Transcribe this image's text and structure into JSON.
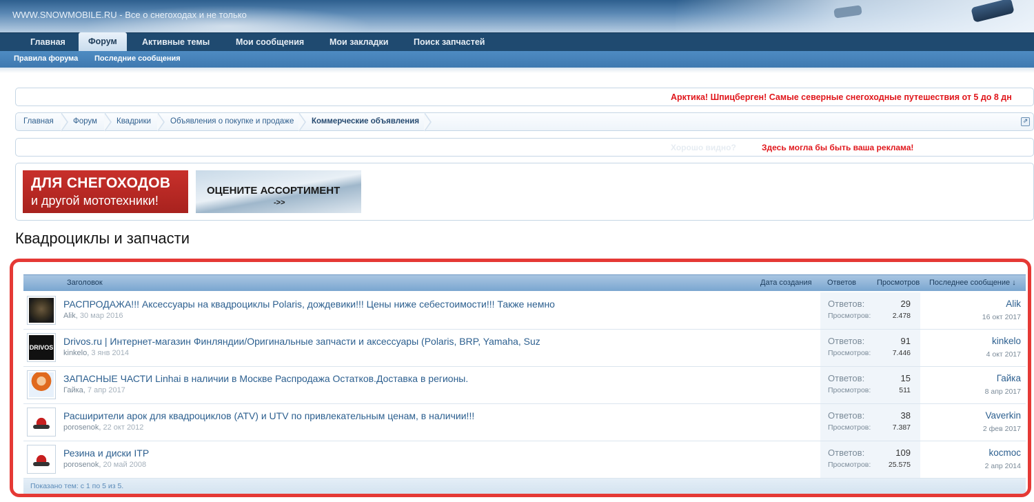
{
  "site": {
    "title": "WWW.SNOWMOBILE.RU - Все о снегоходах и не только"
  },
  "nav": {
    "tabs": [
      "Главная",
      "Форум",
      "Активные темы",
      "Мои сообщения",
      "Мои закладки",
      "Поиск запчастей"
    ],
    "active_tab": "Форум",
    "subtabs": [
      "Правила форума",
      "Последние сообщения"
    ]
  },
  "notice_top": "Арктика! Шпицберген! Самые северные снегоходные путешествия от 5 до 8 дн",
  "breadcrumb": [
    "Главная",
    "Форум",
    "Квадрики",
    "Объявления о покупке и продаже",
    "Коммерческие объявления"
  ],
  "notice_ad": {
    "faded": "Хорошо видно?",
    "link": "Здесь могла бы быть ваша реклама!"
  },
  "banners": [
    {
      "line1": "ДЛЯ СНЕГОХОДОВ",
      "line2": "и другой мототехники!"
    },
    {
      "line1": "ОЦЕНИТЕ АССОРТИМЕНТ",
      "line2": "->>"
    }
  ],
  "page_title": "Квадроциклы и запчасти",
  "list_header": {
    "title": "Заголовок",
    "date": "Дата создания",
    "replies": "Ответов",
    "views": "Просмотров",
    "last_post": "Последнее сообщение ↓"
  },
  "threads": [
    {
      "title": "РАСПРОДАЖА!!! Аксессуары на квадроциклы Polaris, дождевики!!! Цены ниже себестоимости!!! Также немно",
      "author": "Alik",
      "date": "30 мар 2016",
      "replies_label": "Ответов:",
      "replies": "29",
      "views_label": "Просмотров:",
      "views": "2.478",
      "last_user": "Alik",
      "last_date": "16 окт 2017",
      "avatar": "vader-avatar"
    },
    {
      "title": "Drivos.ru | Интернет-магазин Финляндии/Оригинальные запчасти и аксессуары (Polaris, BRP, Yamaha, Suz",
      "author": "kinkelo",
      "date": "3 янв 2014",
      "replies_label": "Ответов:",
      "replies": "91",
      "views_label": "Просмотров:",
      "views": "7.446",
      "last_user": "kinkelo",
      "last_date": "4 окт 2017",
      "avatar": "drivos-logo",
      "avatar_text": "DRIVOS"
    },
    {
      "title": "ЗАПАСНЫЕ ЧАСТИ Linhai в наличии в Москве Распродажа Остатков.Доставка в регионы.",
      "author": "Гайка",
      "date": "7 апр 2017",
      "replies_label": "Ответов:",
      "replies": "15",
      "views_label": "Просмотров:",
      "views": "511",
      "last_user": "Гайка",
      "last_date": "8 апр 2017",
      "avatar": "cartoon-girl-avatar"
    },
    {
      "title": "Расширители арок для квадроциклов (ATV) и UTV по привлекательным ценам, в наличии!!!",
      "author": "porosenok",
      "date": "22 окт 2012",
      "replies_label": "Ответов:",
      "replies": "38",
      "views_label": "Просмотров:",
      "views": "7.387",
      "last_user": "Vaverkin",
      "last_date": "2 фев 2017",
      "avatar": "atv-avatar"
    },
    {
      "title": "Резина и диски ITP",
      "author": "porosenok",
      "date": "20 май 2008",
      "replies_label": "Ответов:",
      "replies": "109",
      "views_label": "Просмотров:",
      "views": "25.575",
      "last_user": "kocmoc",
      "last_date": "2 апр 2014",
      "avatar": "atv-avatar"
    }
  ],
  "footer_text": "Показано тем: с 1 по 5 из 5.",
  "colors": {
    "nav": "#1f4a70",
    "subnav": "#4e8bc2",
    "link": "#2c5f8f",
    "notice_red": "#e0161b",
    "highlight": "#e53935"
  }
}
